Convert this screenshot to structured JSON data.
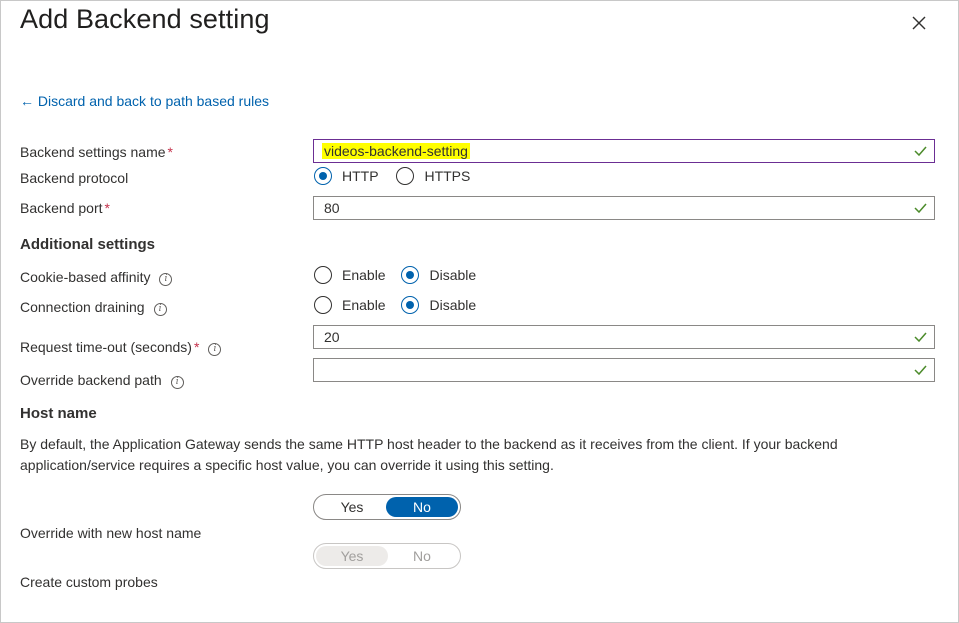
{
  "title": "Add Backend setting",
  "back_link": "← Discard and back to path based rules",
  "fields": {
    "name_label": "Backend settings name",
    "name_value": "videos-backend-setting",
    "protocol_label": "Backend protocol",
    "protocol_options": [
      "HTTP",
      "HTTPS"
    ],
    "protocol_selected": "HTTP",
    "port_label": "Backend port",
    "port_value": "80",
    "required_mark": "*"
  },
  "additional": {
    "heading": "Additional settings",
    "affinity_label": "Cookie-based affinity",
    "draining_label": "Connection draining",
    "enable": "Enable",
    "disable": "Disable",
    "affinity_selected": "Disable",
    "draining_selected": "Disable",
    "timeout_label": "Request time-out (seconds)",
    "timeout_value": "20",
    "path_label": "Override backend path",
    "path_value": ""
  },
  "host": {
    "heading": "Host name",
    "description": "By default, the Application Gateway sends the same HTTP host header to the backend as it receives from the client. If your backend application/service requires a specific host value, you can override it using this setting.",
    "override_label": "Override with new host name",
    "probes_label": "Create custom probes",
    "yes": "Yes",
    "no": "No",
    "override_selected": "No",
    "probes_selected": "Yes"
  },
  "colors": {
    "accent": "#0062ad",
    "valid_check": "#4c8b2b",
    "required": "#c4314b",
    "highlight": "#ffff00"
  }
}
